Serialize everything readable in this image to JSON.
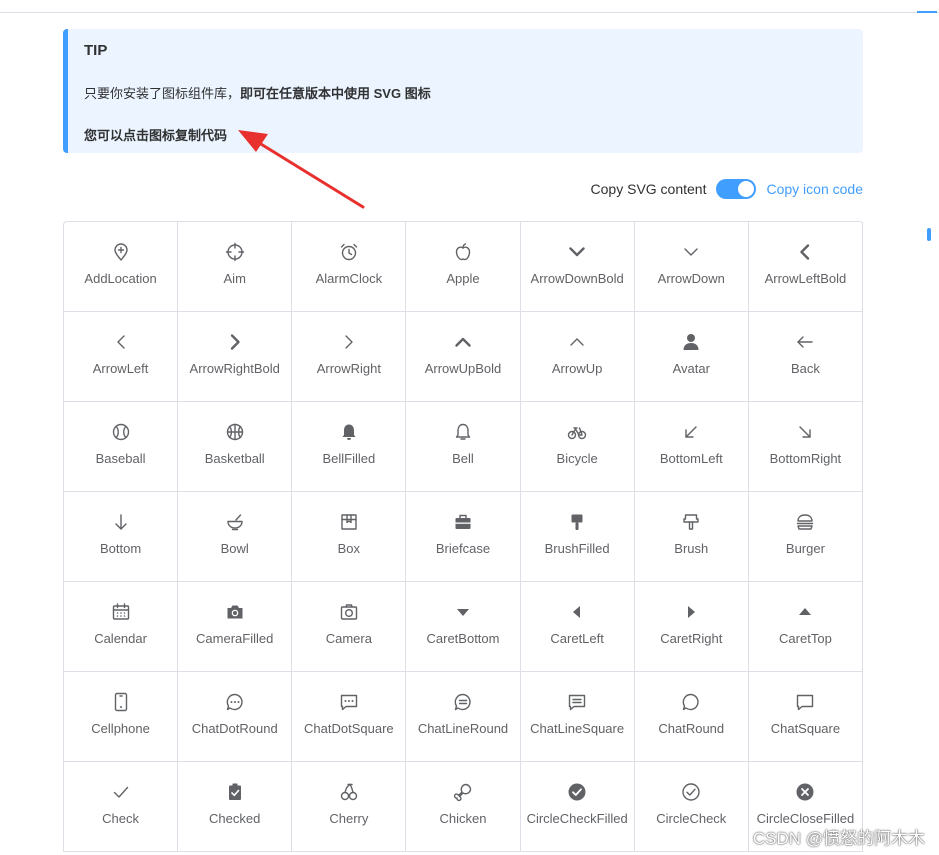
{
  "tip": {
    "title": "TIP",
    "line1_prefix": "只要你安装了图标组件库，",
    "line1_bold": "即可在任意版本中使用 SVG 图标",
    "line2": "您可以点击图标复制代码"
  },
  "copy_row": {
    "left_label": "Copy SVG content",
    "right_label": "Copy icon code",
    "switch_on": true
  },
  "icons": [
    "AddLocation",
    "Aim",
    "AlarmClock",
    "Apple",
    "ArrowDownBold",
    "ArrowDown",
    "ArrowLeftBold",
    "ArrowLeft",
    "ArrowRightBold",
    "ArrowRight",
    "ArrowUpBold",
    "ArrowUp",
    "Avatar",
    "Back",
    "Baseball",
    "Basketball",
    "BellFilled",
    "Bell",
    "Bicycle",
    "BottomLeft",
    "BottomRight",
    "Bottom",
    "Bowl",
    "Box",
    "Briefcase",
    "BrushFilled",
    "Brush",
    "Burger",
    "Calendar",
    "CameraFilled",
    "Camera",
    "CaretBottom",
    "CaretLeft",
    "CaretRight",
    "CaretTop",
    "Cellphone",
    "ChatDotRound",
    "ChatDotSquare",
    "ChatLineRound",
    "ChatLineSquare",
    "ChatRound",
    "ChatSquare",
    "Check",
    "Checked",
    "Cherry",
    "Chicken",
    "CircleCheckFilled",
    "CircleCheck",
    "CircleCloseFilled"
  ],
  "watermark": "CSDN @愤怒的阿木木",
  "colors": {
    "accent": "#409eff",
    "tip_bg": "#ecf5ff",
    "border": "#dcdfe6",
    "icon": "#606266"
  }
}
